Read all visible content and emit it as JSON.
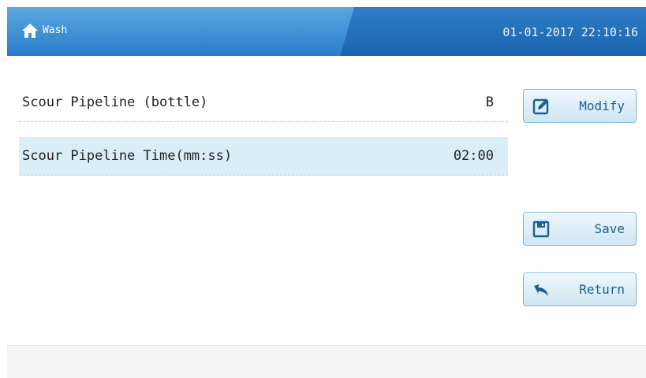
{
  "header": {
    "title": "Wash",
    "datetime": "01-01-2017 22:10:16",
    "icon": "home-icon"
  },
  "params": [
    {
      "label": "Scour Pipeline (bottle)",
      "value": "B",
      "selected": false
    },
    {
      "label": "Scour Pipeline Time(mm:ss)",
      "value": "02:00",
      "selected": true
    }
  ],
  "buttons": {
    "modify": {
      "label": "Modify",
      "icon": "edit-icon"
    },
    "save": {
      "label": "Save",
      "icon": "save-icon"
    },
    "return": {
      "label": "Return",
      "icon": "return-icon"
    }
  },
  "colors": {
    "header": "#1a63ad",
    "selected_row": "#daeef8",
    "button_text": "#1a5f96"
  }
}
